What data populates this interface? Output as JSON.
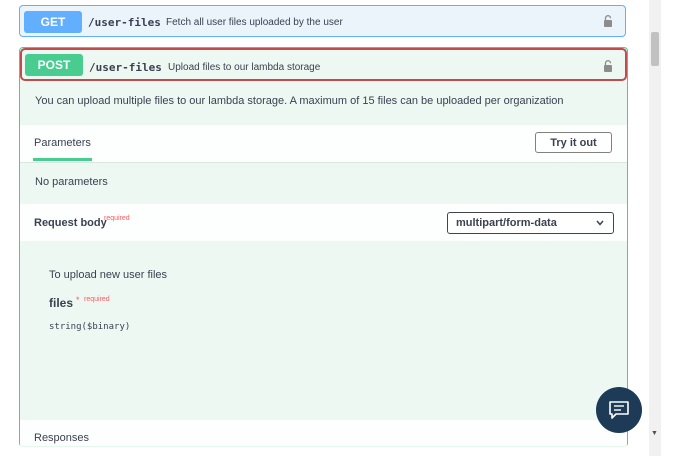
{
  "get_endpoint": {
    "method": "GET",
    "path": "/user-files",
    "summary": "Fetch all user files uploaded by the user"
  },
  "post_endpoint": {
    "method": "POST",
    "path": "/user-files",
    "summary": "Upload files to our lambda storage",
    "description": "You can upload multiple files to our lambda storage. A maximum of 15 files can be uploaded per organization",
    "parameters_tab": "Parameters",
    "try_it_out": "Try it out",
    "no_parameters": "No parameters",
    "request_body_label": "Request body",
    "required_label": "required",
    "content_type": "multipart/form-data",
    "upload_description": "To upload new user files",
    "field_name": "files",
    "field_star": "*",
    "field_required": "required",
    "field_type": "string($binary)",
    "responses_label": "Responses"
  },
  "colors": {
    "get": "#61affe",
    "post": "#49cc90",
    "highlight_border": "#c04b4b",
    "required": "#ff5c5c",
    "chat_button": "#1d3a57"
  },
  "icons": {
    "lock": "lock-icon",
    "chevron": "chevron-down-icon",
    "chat": "chat-icon"
  }
}
